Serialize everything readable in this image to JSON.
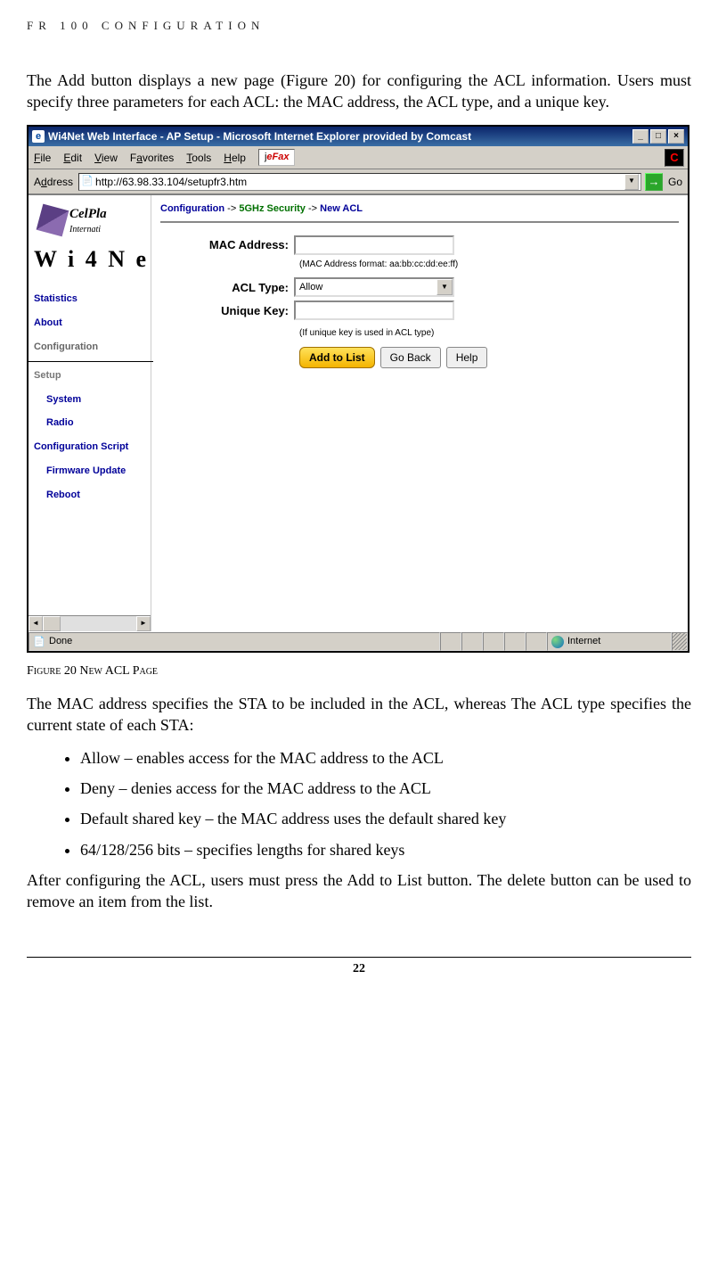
{
  "doc": {
    "header": "FR 100 CONFIGURATION",
    "intro": " The Add button displays a new page (Figure 20) for configuring the ACL information. Users must specify three parameters for each ACL: the MAC address, the ACL type, and a unique key.",
    "figcaption": "Figure 20 New ACL Page",
    "para2": "The MAC address specifies the STA to be included in the ACL, whereas The ACL type specifies the current state of each STA:",
    "bullets": [
      "Allow – enables access for the MAC address to the ACL",
      "Deny – denies access for the MAC address to the ACL",
      "Default shared key – the MAC address uses the default shared key",
      "64/128/256 bits – specifies lengths for shared keys"
    ],
    "para3": "After configuring the ACL, users must press the Add to List button. The delete button can be used to remove an item from the list.",
    "page_number": "22"
  },
  "window": {
    "title": "Wi4Net Web Interface - AP Setup - Microsoft Internet Explorer provided by Comcast",
    "min": "_",
    "max": "□",
    "close": "×"
  },
  "menu": {
    "file": "File",
    "edit": "Edit",
    "view": "View",
    "favorites": "Favorites",
    "tools": "Tools",
    "help": "Help",
    "efax": "eFax",
    "throbber": "C"
  },
  "address": {
    "label": "Address",
    "url": "http://63.98.33.104/setupfr3.htm",
    "go": "Go"
  },
  "logo": {
    "brand": "CelPla",
    "sub": "Internati",
    "wi": "W i 4 N e"
  },
  "nav": {
    "statistics": "Statistics",
    "about": "About",
    "configuration": "Configuration",
    "setup": "Setup",
    "system": "System",
    "radio": "Radio",
    "cfgscript": "Configuration Script",
    "firmware": "Firmware Update",
    "reboot": "Reboot"
  },
  "breadcrumb": {
    "conf": "Configuration",
    "arrow": "->",
    "security": "5GHz Security",
    "newacl": "New ACL"
  },
  "form": {
    "mac_label": "MAC Address:",
    "mac_hint": "(MAC Address format: aa:bb:cc:dd:ee:ff)",
    "acl_label": "ACL Type:",
    "acl_value": "Allow",
    "key_label": "Unique Key:",
    "key_hint": "(If unique key is used in ACL type)",
    "btn_add": "Add to List",
    "btn_back": "Go Back",
    "btn_help": "Help"
  },
  "status": {
    "done": "Done",
    "zone": "Internet"
  }
}
